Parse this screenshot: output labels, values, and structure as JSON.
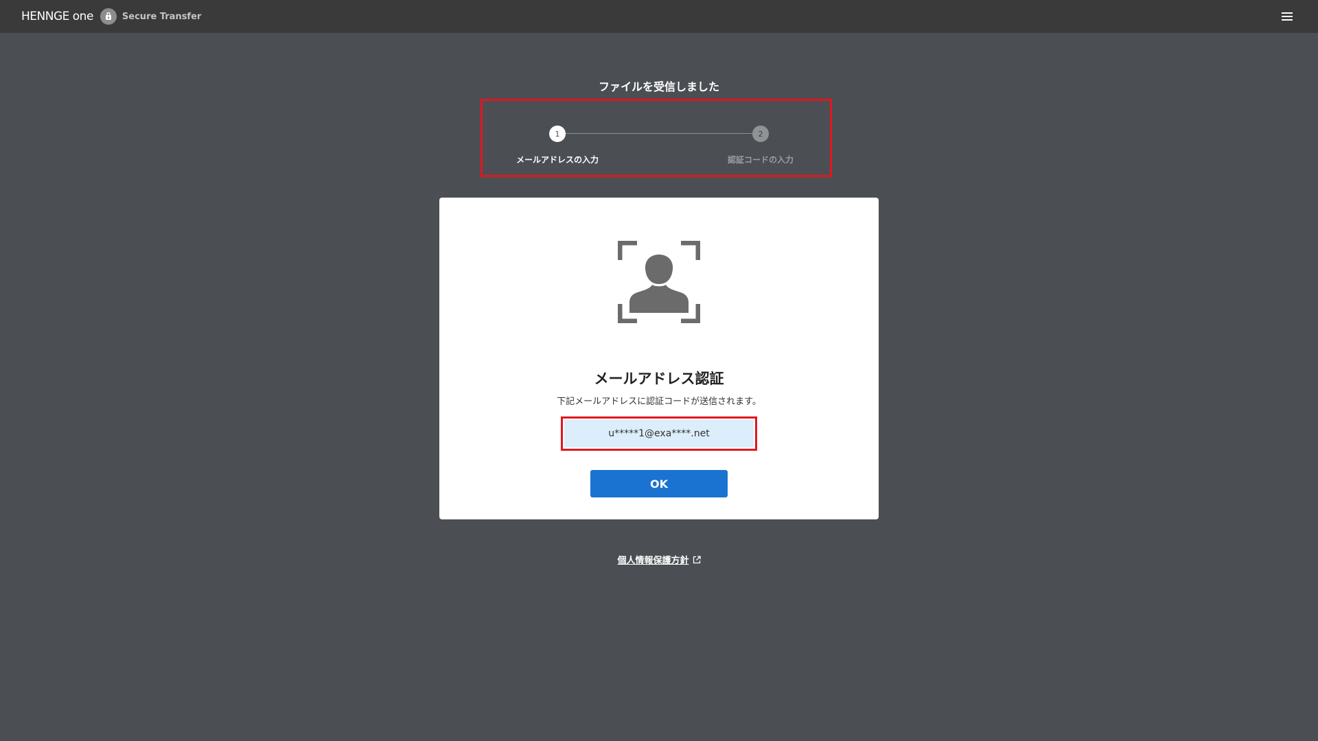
{
  "header": {
    "brand_name": "HENNGE one",
    "product_name": "Secure Transfer",
    "menu_icon": "hamburger-menu-icon",
    "brand_badge_icon": "lock-bag-icon"
  },
  "page": {
    "title": "ファイルを受信しました"
  },
  "steps": [
    {
      "number": "1",
      "label": "メールアドレスの入力",
      "state": "active"
    },
    {
      "number": "2",
      "label": "認証コードの入力",
      "state": "inactive"
    }
  ],
  "card": {
    "icon": "user-face-scan-icon",
    "heading": "メールアドレス認証",
    "description": "下記メールアドレスに認証コードが送信されます。",
    "email": "u*****1@exa****.net",
    "ok_label": "OK"
  },
  "footer": {
    "privacy_label": "個人情報保護方針",
    "external_icon": "external-link-icon"
  },
  "colors": {
    "background": "#4b4f53",
    "topbar": "#3a3a3a",
    "primary_button": "#1a73d0",
    "highlight_border": "#e5141e",
    "email_box": "#dceefb"
  }
}
